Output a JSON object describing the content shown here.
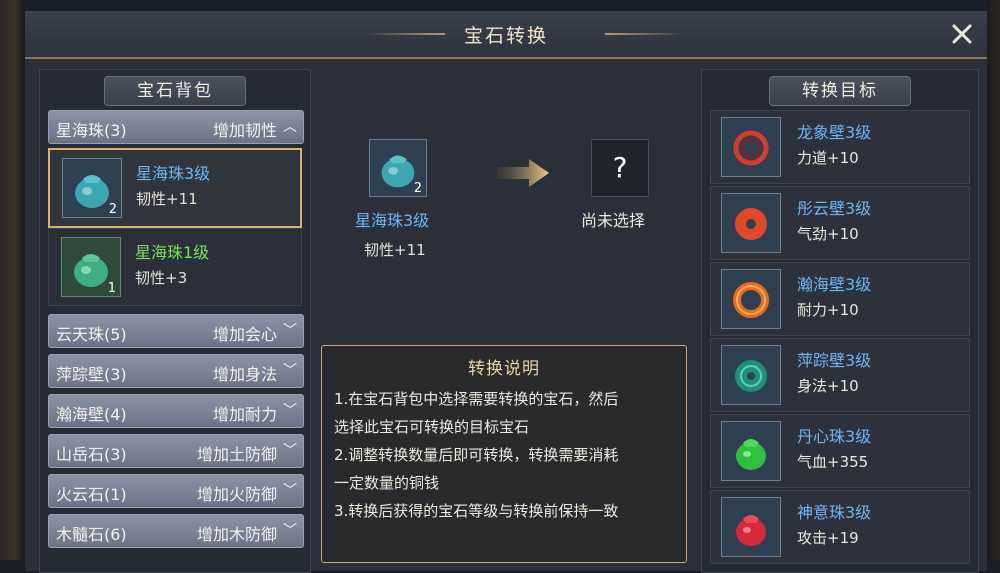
{
  "window": {
    "title": "宝石转换"
  },
  "left_panel": {
    "header": "宝石背包",
    "expanded_category": {
      "name": "星海珠(3)",
      "desc": "增加韧性"
    },
    "items": [
      {
        "name": "星海珠3级",
        "effect": "韧性+11",
        "count": "2",
        "selected": true
      },
      {
        "name": "星海珠1级",
        "effect": "韧性+3",
        "count": "1",
        "selected": false
      }
    ],
    "categories": [
      {
        "name": "云天珠(5)",
        "desc": "增加会心"
      },
      {
        "name": "萍踪壁(3)",
        "desc": "增加身法"
      },
      {
        "name": "瀚海壁(4)",
        "desc": "增加耐力"
      },
      {
        "name": "山岳石(3)",
        "desc": "增加土防御"
      },
      {
        "name": "火云石(1)",
        "desc": "增加火防御"
      },
      {
        "name": "木髓石(6)",
        "desc": "增加木防御"
      }
    ]
  },
  "center": {
    "source": {
      "name": "星海珠3级",
      "effect": "韧性+11",
      "count": "2"
    },
    "target_placeholder": {
      "symbol": "?",
      "label": "尚未选择"
    }
  },
  "explanation": {
    "title": "转换说明",
    "lines": [
      "1.在宝石背包中选择需要转换的宝石，然后",
      "选择此宝石可转换的目标宝石",
      "2.调整转换数量后即可转换，转换需要消耗",
      "一定数量的铜钱",
      "3.转换后获得的宝石等级与转换前保持一致"
    ]
  },
  "right_panel": {
    "header": "转换目标",
    "targets": [
      {
        "name": "龙象壁3级",
        "effect": "力道+10",
        "icon": "red-ring-gem-icon"
      },
      {
        "name": "彤云壁3级",
        "effect": "气劲+10",
        "icon": "red-disc-gem-icon"
      },
      {
        "name": "瀚海壁3级",
        "effect": "耐力+10",
        "icon": "orange-ring-gem-icon"
      },
      {
        "name": "萍踪壁3级",
        "effect": "身法+10",
        "icon": "teal-disc-gem-icon"
      },
      {
        "name": "丹心珠3级",
        "effect": "气血+355",
        "icon": "green-pouch-gem-icon"
      },
      {
        "name": "神意珠3级",
        "effect": "攻击+19",
        "icon": "red-pouch-gem-icon"
      }
    ]
  },
  "colors": {
    "gem_name_blue": "#6fb6f0",
    "gem_name_green": "#7be25f",
    "selected_border": "#d7b26a"
  }
}
